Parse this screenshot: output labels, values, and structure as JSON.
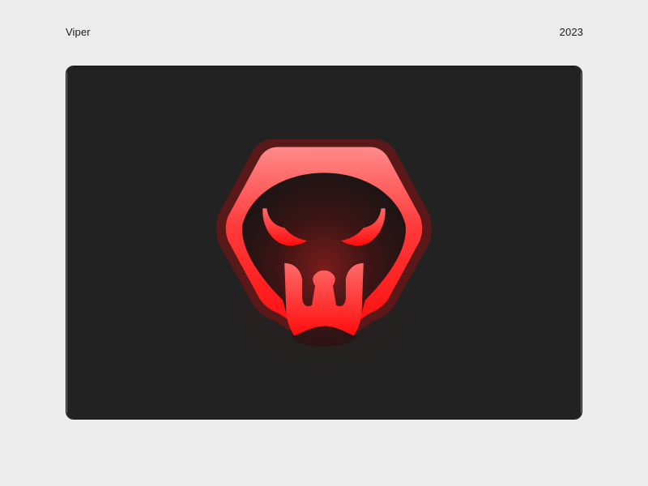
{
  "header": {
    "title": "Viper",
    "year": "2023"
  },
  "showcase": {
    "background": "#222222",
    "logo": {
      "icon": "viper-skull-icon",
      "colors": {
        "primary": "#ff1a1a",
        "highlight": "#ff7a7a",
        "outline": "#5a1a1a",
        "glow": "#9a1f1f"
      }
    }
  }
}
